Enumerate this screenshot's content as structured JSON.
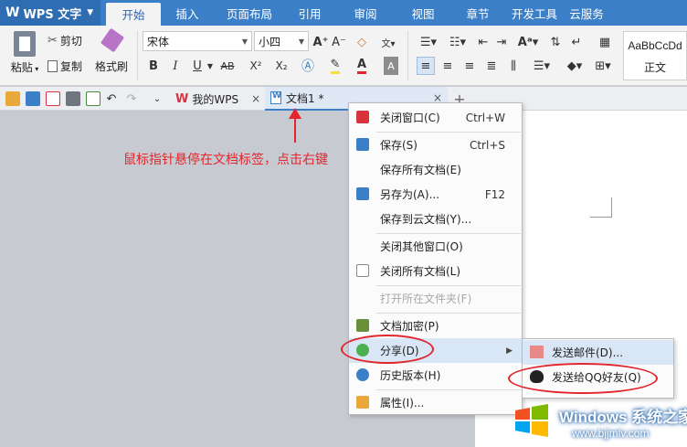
{
  "app": {
    "name": "WPS 文字"
  },
  "ribbon_tabs": [
    "开始",
    "插入",
    "页面布局",
    "引用",
    "审阅",
    "视图",
    "章节",
    "开发工具",
    "云服务"
  ],
  "active_tab": "开始",
  "clipboard": {
    "paste": "粘贴",
    "cut": "剪切",
    "copy": "复制",
    "format_painter": "格式刷"
  },
  "font": {
    "name": "宋体",
    "size": "小四"
  },
  "format_buttons": {
    "bold": "B",
    "italic": "I",
    "underline": "U",
    "strike": "AB",
    "superscript": "X²",
    "subscript": "X₂",
    "font_color": "A"
  },
  "styles": {
    "preview": "AaBbCcDd",
    "normal": "正文"
  },
  "doc_tabs": [
    {
      "label": "我的WPS",
      "close": "×"
    },
    {
      "label": "文档1 *",
      "close": "×"
    }
  ],
  "new_tab": "+",
  "annotation": {
    "text": "鼠标指针悬停在文档标签，点击右键"
  },
  "context_menu": {
    "items": [
      {
        "label": "关闭窗口(C)",
        "shortcut": "Ctrl+W",
        "icon": "close-window-icon"
      },
      {
        "label": "保存(S)",
        "shortcut": "Ctrl+S",
        "icon": "save-icon"
      },
      {
        "label": "保存所有文档(E)",
        "shortcut": ""
      },
      {
        "label": "另存为(A)...",
        "shortcut": "F12",
        "icon": "save-as-icon"
      },
      {
        "label": "保存到云文档(Y)...",
        "shortcut": ""
      },
      {
        "label": "关闭其他窗口(O)",
        "shortcut": ""
      },
      {
        "label": "关闭所有文档(L)",
        "shortcut": "",
        "icon": "close-all-icon"
      },
      {
        "label": "打开所在文件夹(F)",
        "shortcut": "",
        "disabled": true
      },
      {
        "label": "文档加密(P)",
        "shortcut": "",
        "icon": "lock-icon"
      },
      {
        "label": "分享(D)",
        "shortcut": "",
        "icon": "share-icon",
        "highlighted": true,
        "submenu": true
      },
      {
        "label": "历史版本(H)",
        "shortcut": "",
        "icon": "history-icon"
      },
      {
        "label": "属性(I)...",
        "shortcut": "",
        "icon": "properties-icon"
      }
    ]
  },
  "share_submenu": {
    "items": [
      {
        "label": "发送邮件(D)...",
        "icon": "mail-icon"
      },
      {
        "label": "发送给QQ好友(Q)",
        "icon": "qq-icon"
      }
    ]
  },
  "watermark": {
    "line1": "Windows 系统之家",
    "line2": "www.bjjmlv.com"
  },
  "colors": {
    "accent": "#3c7fc9",
    "annotation": "#e3262e",
    "menu_highlight": "#d9e6f5"
  }
}
